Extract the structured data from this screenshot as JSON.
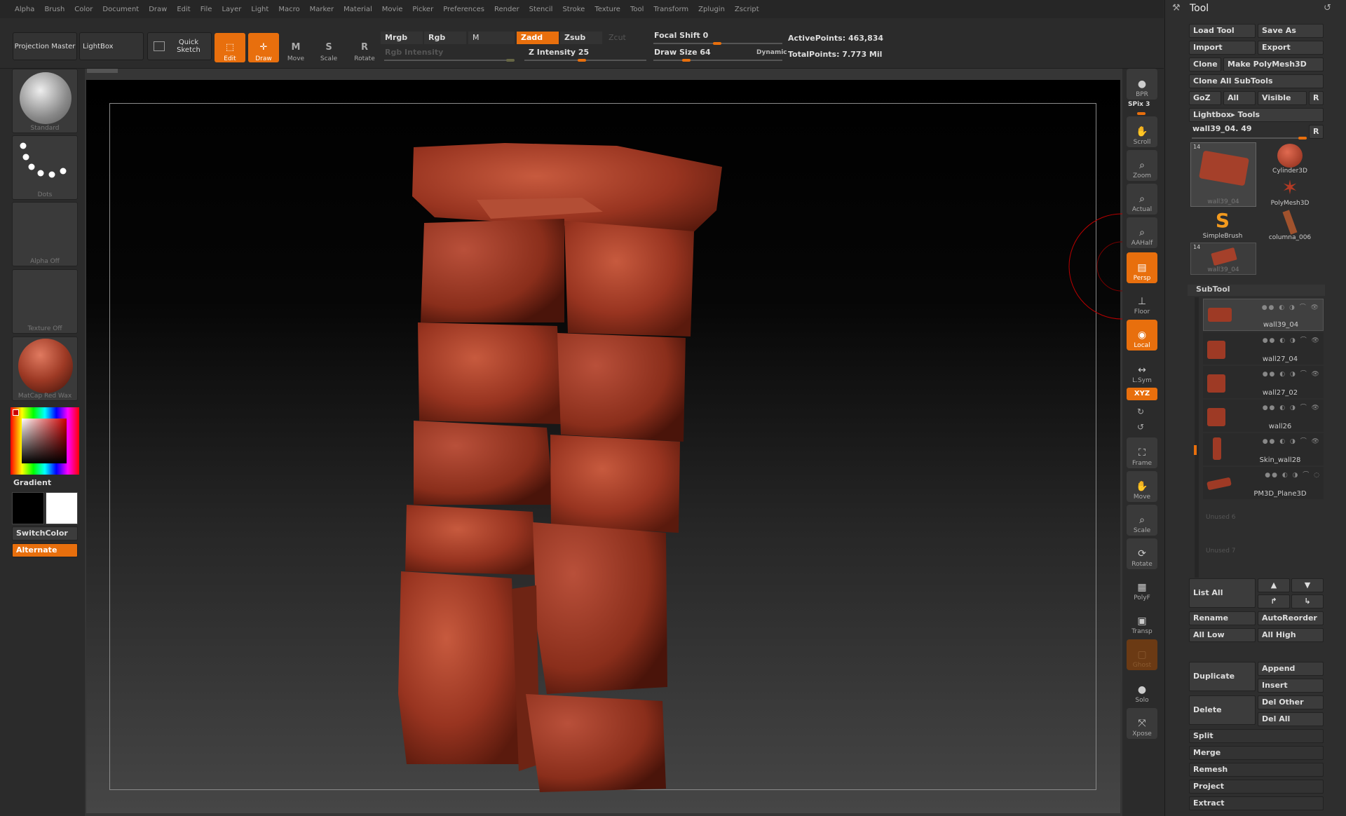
{
  "menu": [
    "Alpha",
    "Brush",
    "Color",
    "Document",
    "Draw",
    "Edit",
    "File",
    "Layer",
    "Light",
    "Macro",
    "Marker",
    "Material",
    "Movie",
    "Picker",
    "Preferences",
    "Render",
    "Stencil",
    "Stroke",
    "Texture",
    "Tool",
    "Transform",
    "Zplugin",
    "Zscript"
  ],
  "toolbar": {
    "projection_master": "Projection Master",
    "lightbox": "LightBox",
    "quick_sketch": "Quick Sketch",
    "edit": "Edit",
    "draw": "Draw",
    "move": "Move",
    "scale": "Scale",
    "rotate": "Rotate",
    "mrgb": "Mrgb",
    "rgb": "Rgb",
    "m": "M",
    "zadd": "Zadd",
    "zsub": "Zsub",
    "zcut": "Zcut",
    "rgb_intensity": "Rgb Intensity",
    "z_intensity": "Z Intensity 25",
    "focal_shift": "Focal Shift 0",
    "draw_size": "Draw Size 64",
    "dynamic": "Dynamic",
    "active_points": "ActivePoints: 463,834",
    "total_points": "TotalPoints: 7.773 Mil"
  },
  "left": {
    "brush": "Standard",
    "stroke": "Dots",
    "alpha": "Alpha Off",
    "texture": "Texture Off",
    "material": "MatCap Red Wax",
    "gradient": "Gradient",
    "switch_color": "SwitchColor",
    "alternate": "Alternate"
  },
  "right": {
    "bpr": "BPR",
    "spix": "SPix 3",
    "scroll": "Scroll",
    "zoom": "Zoom",
    "actual": "Actual",
    "aahalf": "AAHalf",
    "persp": "Persp",
    "floor": "Floor",
    "local": "Local",
    "lsym": "L.Sym",
    "xyz": "XYZ",
    "frame": "Frame",
    "move": "Move",
    "scale": "Scale",
    "rotate": "Rotate",
    "polyf": "PolyF",
    "transp": "Transp",
    "ghost": "Ghost",
    "solo": "Solo",
    "xpose": "Xpose"
  },
  "tool": {
    "title": "Tool",
    "load": "Load Tool",
    "save_as": "Save As",
    "import": "Import",
    "export": "Export",
    "clone": "Clone",
    "make_polymesh": "Make PolyMesh3D",
    "clone_all": "Clone All SubTools",
    "goz": "GoZ",
    "all": "All",
    "visible": "Visible",
    "r": "R",
    "lightbox_tools": "Lightbox▸ Tools",
    "current": "wall39_04. 49",
    "tiles": [
      {
        "name": "wall39_04",
        "count": "14"
      },
      {
        "name": "Cylinder3D"
      },
      {
        "name": "PolyMesh3D"
      },
      {
        "name": "SimpleBrush"
      },
      {
        "name": "columna_006"
      },
      {
        "name": "wall39_04",
        "count": "14"
      }
    ],
    "subtool_title": "SubTool",
    "subtools": [
      "wall39_04",
      "wall27_04",
      "wall27_02",
      "wall26",
      "Skin_wall28",
      "PM3D_Plane3D"
    ],
    "unused": [
      "Unused 6",
      "Unused 7"
    ],
    "list_all": "List All",
    "rename": "Rename",
    "autoreorder": "AutoReorder",
    "all_low": "All Low",
    "all_high": "All High",
    "duplicate": "Duplicate",
    "append": "Append",
    "insert": "Insert",
    "delete": "Delete",
    "del_other": "Del Other",
    "del_all": "Del All",
    "split": "Split",
    "merge": "Merge",
    "remesh": "Remesh",
    "project": "Project",
    "extract": "Extract"
  },
  "colors": {
    "accent": "#e86f0d",
    "clay": "#9e3a25"
  }
}
